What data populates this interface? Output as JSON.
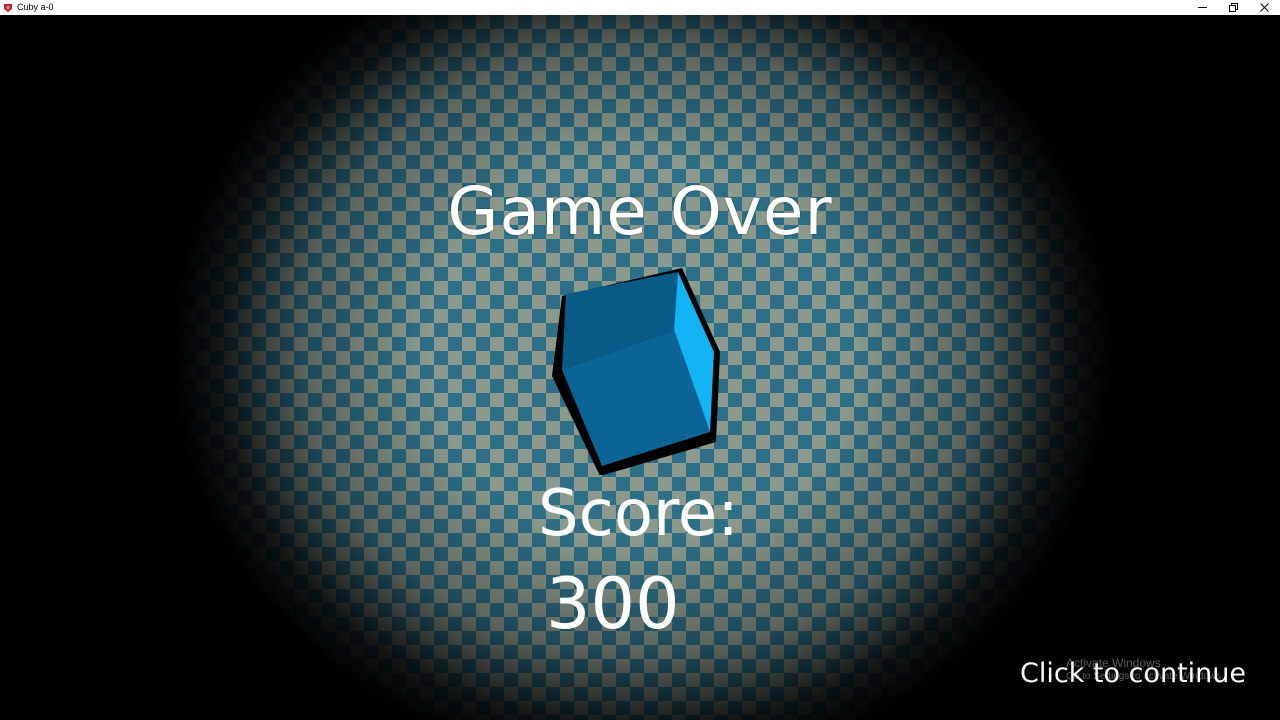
{
  "window": {
    "title": "Cuby a-0",
    "controls": [
      "minimize",
      "restore",
      "close"
    ]
  },
  "game": {
    "heading": "Game Over",
    "score_label": "Score:",
    "score_value": "300",
    "continue_prompt": "Click to continue",
    "cube_icon": "cube-icon"
  },
  "os_watermark": {
    "line1": "Activate Windows",
    "line2": "Go to Settings to activate Windows."
  },
  "colors": {
    "checker_dark": "#2d6f86",
    "checker_light": "#8c9a8e",
    "cube_front": "#0a6496",
    "cube_top": "#085b87",
    "cube_side": "#12b4f5",
    "text": "#ffffff"
  }
}
